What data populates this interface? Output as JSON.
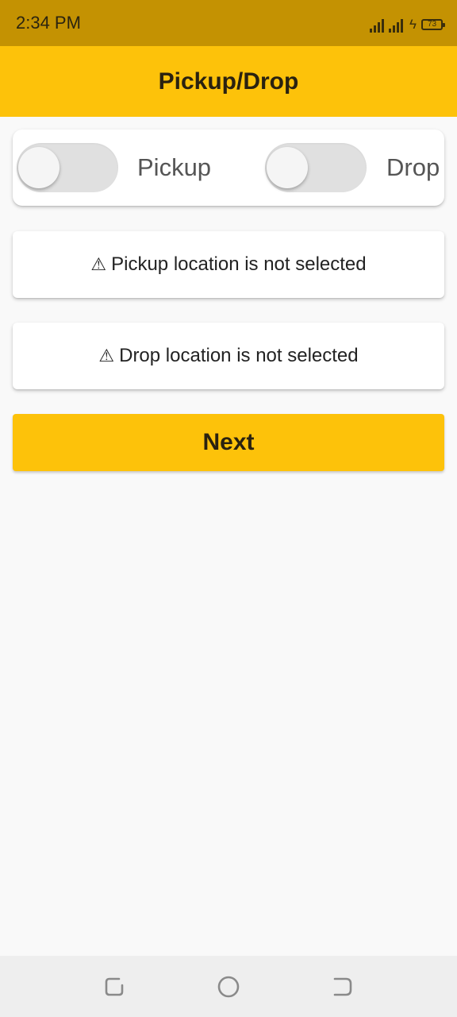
{
  "status_bar": {
    "time": "2:34 PM",
    "battery_level": "73",
    "icons": [
      "signal-icon",
      "signal-icon",
      "charging-icon",
      "battery-icon"
    ]
  },
  "app_bar": {
    "title": "Pickup/Drop"
  },
  "toggles": {
    "pickup_label": "Pickup",
    "pickup_on": false,
    "drop_label": "Drop",
    "drop_on": false
  },
  "messages": {
    "warning_symbol": "⚠",
    "pickup_warning": "Pickup location is not selected",
    "drop_warning": "Drop location is not selected"
  },
  "actions": {
    "next_label": "Next"
  },
  "nav_bar": {
    "icons": [
      "recents-icon",
      "home-icon",
      "back-icon"
    ]
  },
  "colors": {
    "status_bar": "#c49202",
    "accent": "#fdc20a",
    "background": "#f9f9f9",
    "nav_bar": "#eeeeee"
  }
}
